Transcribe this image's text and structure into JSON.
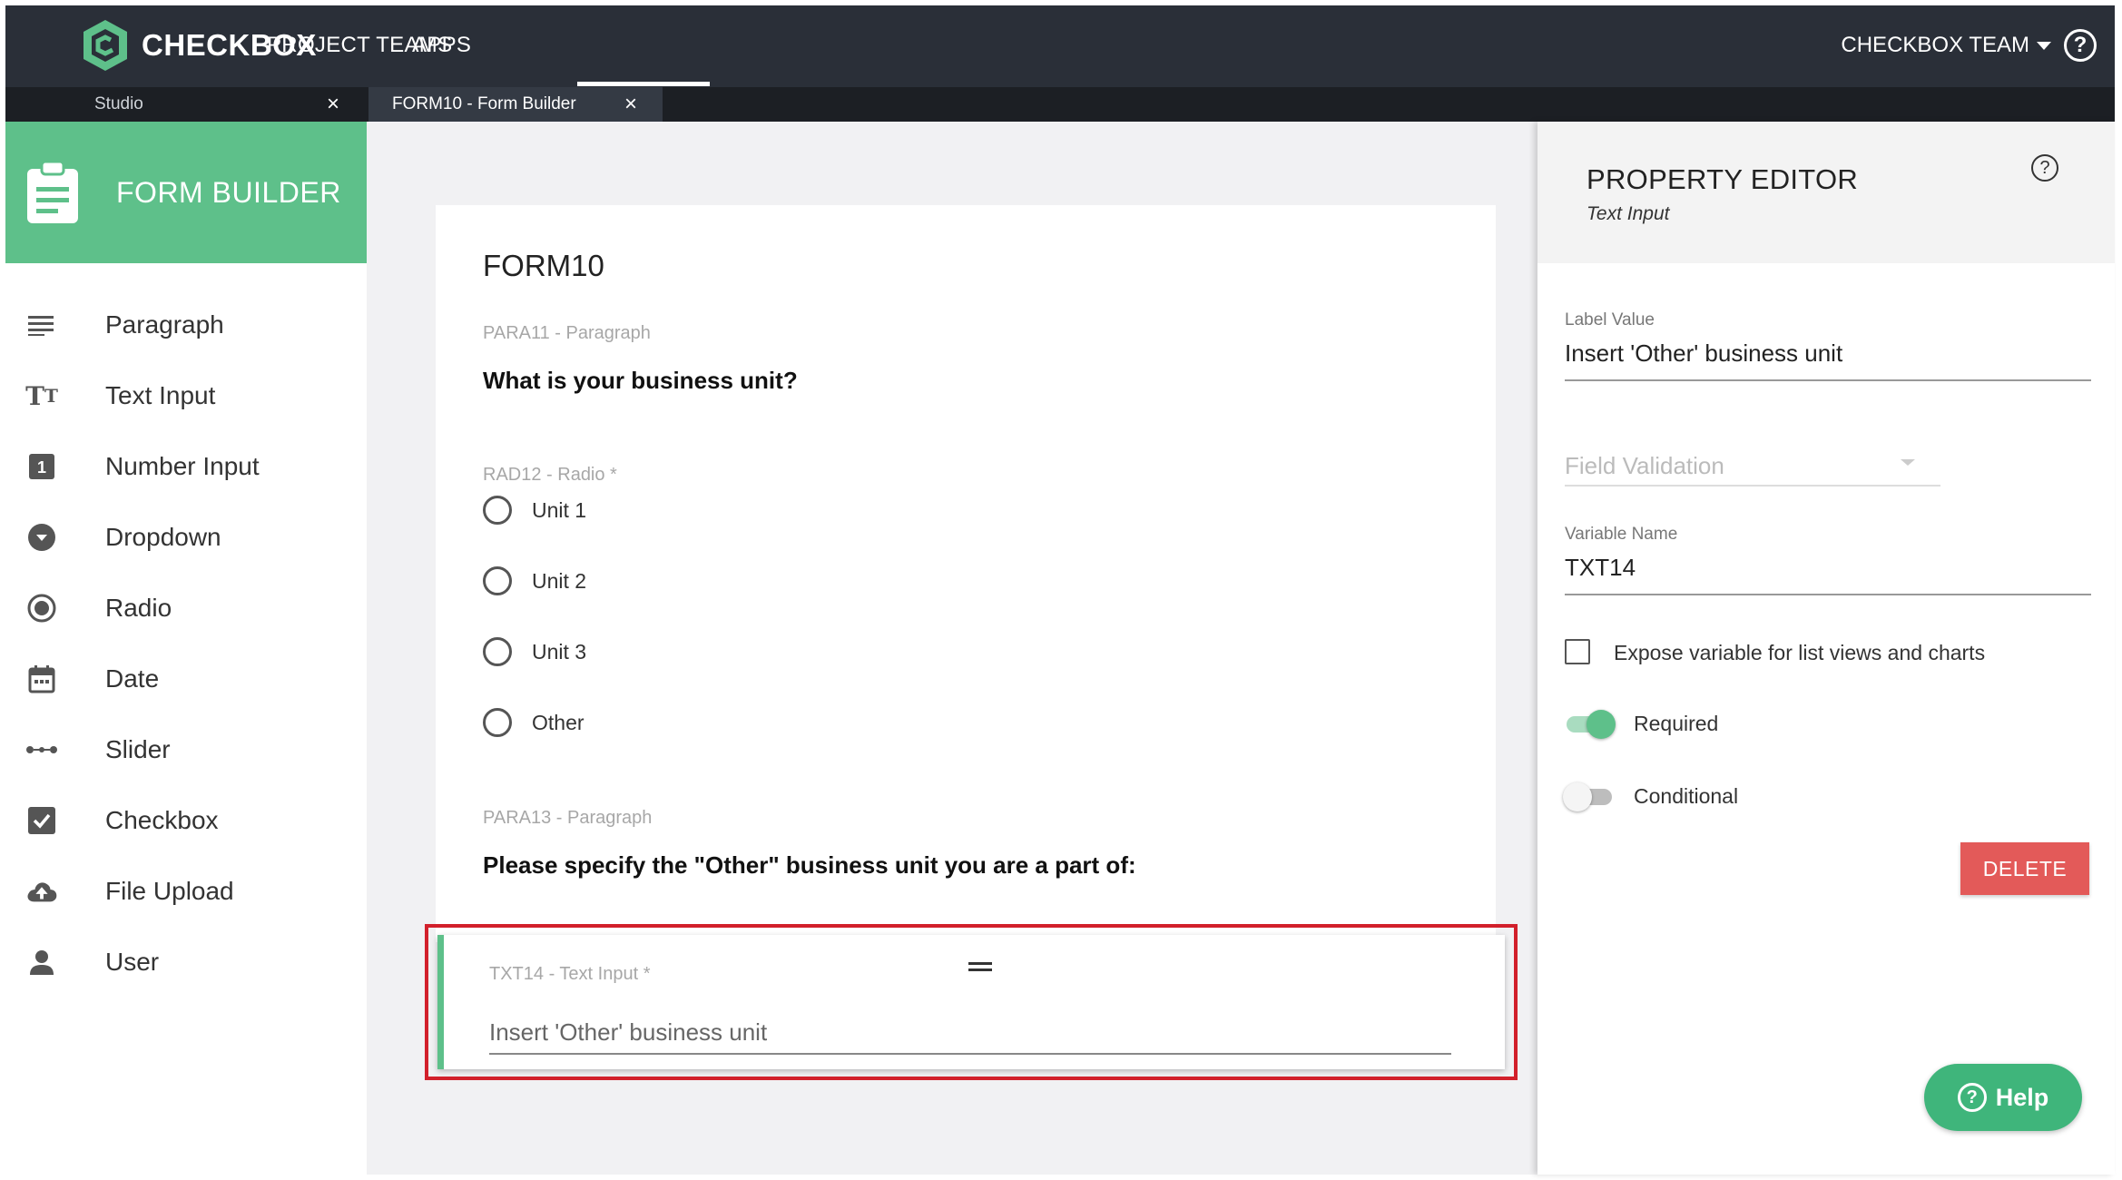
{
  "app": {
    "brand": "CHECKBOX",
    "nav": [
      "PROJECT TEAMS",
      "APPS"
    ],
    "team": "CHECKBOX TEAM",
    "colors": {
      "nav_bg": "#2a2f38",
      "accent": "#5ec08a",
      "highlight": "#d2202b",
      "delete": "#e35a59"
    }
  },
  "tabs": [
    {
      "label": "Studio",
      "close": "×"
    },
    {
      "label": "FORM10 - Form Builder",
      "close": "×"
    }
  ],
  "sidebar": {
    "title": "FORM BUILDER",
    "items": [
      {
        "label": "Paragraph",
        "icon": "paragraph-icon"
      },
      {
        "label": "Text Input",
        "icon": "text-input-icon"
      },
      {
        "label": "Number Input",
        "icon": "number-input-icon"
      },
      {
        "label": "Dropdown",
        "icon": "dropdown-icon"
      },
      {
        "label": "Radio",
        "icon": "radio-icon"
      },
      {
        "label": "Date",
        "icon": "calendar-icon"
      },
      {
        "label": "Slider",
        "icon": "slider-icon"
      },
      {
        "label": "Checkbox",
        "icon": "checkbox-icon"
      },
      {
        "label": "File Upload",
        "icon": "cloud-upload-icon"
      },
      {
        "label": "User",
        "icon": "user-icon"
      }
    ]
  },
  "form": {
    "title": "FORM10",
    "para1_meta": "PARA11 - Paragraph",
    "para1_text": "What is your business unit?",
    "radio_meta": "RAD12 - Radio *",
    "radio_options": [
      "Unit 1",
      "Unit 2",
      "Unit 3",
      "Other"
    ],
    "para2_meta": "PARA13 - Paragraph",
    "para2_text": "Please specify the \"Other\" business unit you are a part of:",
    "text_input_meta": "TXT14 - Text Input *",
    "text_input_placeholder": "Insert 'Other' business unit"
  },
  "property_editor": {
    "title": "PROPERTY EDITOR",
    "subtitle": "Text Input",
    "label_value_label": "Label Value",
    "label_value": "Insert 'Other' business unit",
    "field_validation_placeholder": "Field Validation",
    "variable_name_label": "Variable Name",
    "variable_name": "TXT14",
    "expose_label": "Expose variable for list views and charts",
    "expose_checked": false,
    "required_label": "Required",
    "required_on": true,
    "conditional_label": "Conditional",
    "conditional_on": false,
    "delete_label": "DELETE",
    "help_label": "Help"
  }
}
